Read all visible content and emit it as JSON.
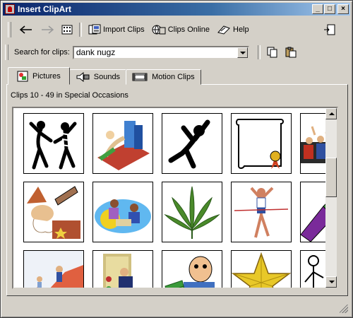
{
  "window": {
    "title": "Insert ClipArt"
  },
  "titlebar_buttons": {
    "minimize": "_",
    "maximize": "□",
    "close": "×"
  },
  "toolbar": {
    "import_clips_label": "Import Clips",
    "clips_online_label": "Clips Online",
    "help_label": "Help"
  },
  "search": {
    "label": "Search for clips:",
    "value": "dank nugz"
  },
  "tabs": [
    {
      "label": "Pictures"
    },
    {
      "label": "Sounds"
    },
    {
      "label": "Motion Clips"
    }
  ],
  "gallery": {
    "caption": "Clips 10 - 49 in Special Occasions",
    "clips": [
      "dancing-people-clip",
      "office-buildings-clip",
      "jumping-figure-clip",
      "scroll-diploma-clip",
      "audience-crowd-clip",
      "astronomer-wizard-clip",
      "business-handshake-clip",
      "marijuana-leaf-clip",
      "runner-finish-line-clip",
      "purple-object-clip",
      "growth-chart-clip",
      "businessman-door-clip",
      "money-man-clip",
      "gold-star-clip",
      "figure-sketch-clip"
    ]
  },
  "colors": {
    "titlebar_start": "#0a246a",
    "titlebar_end": "#a6caf0",
    "face": "#d4d0c8"
  }
}
